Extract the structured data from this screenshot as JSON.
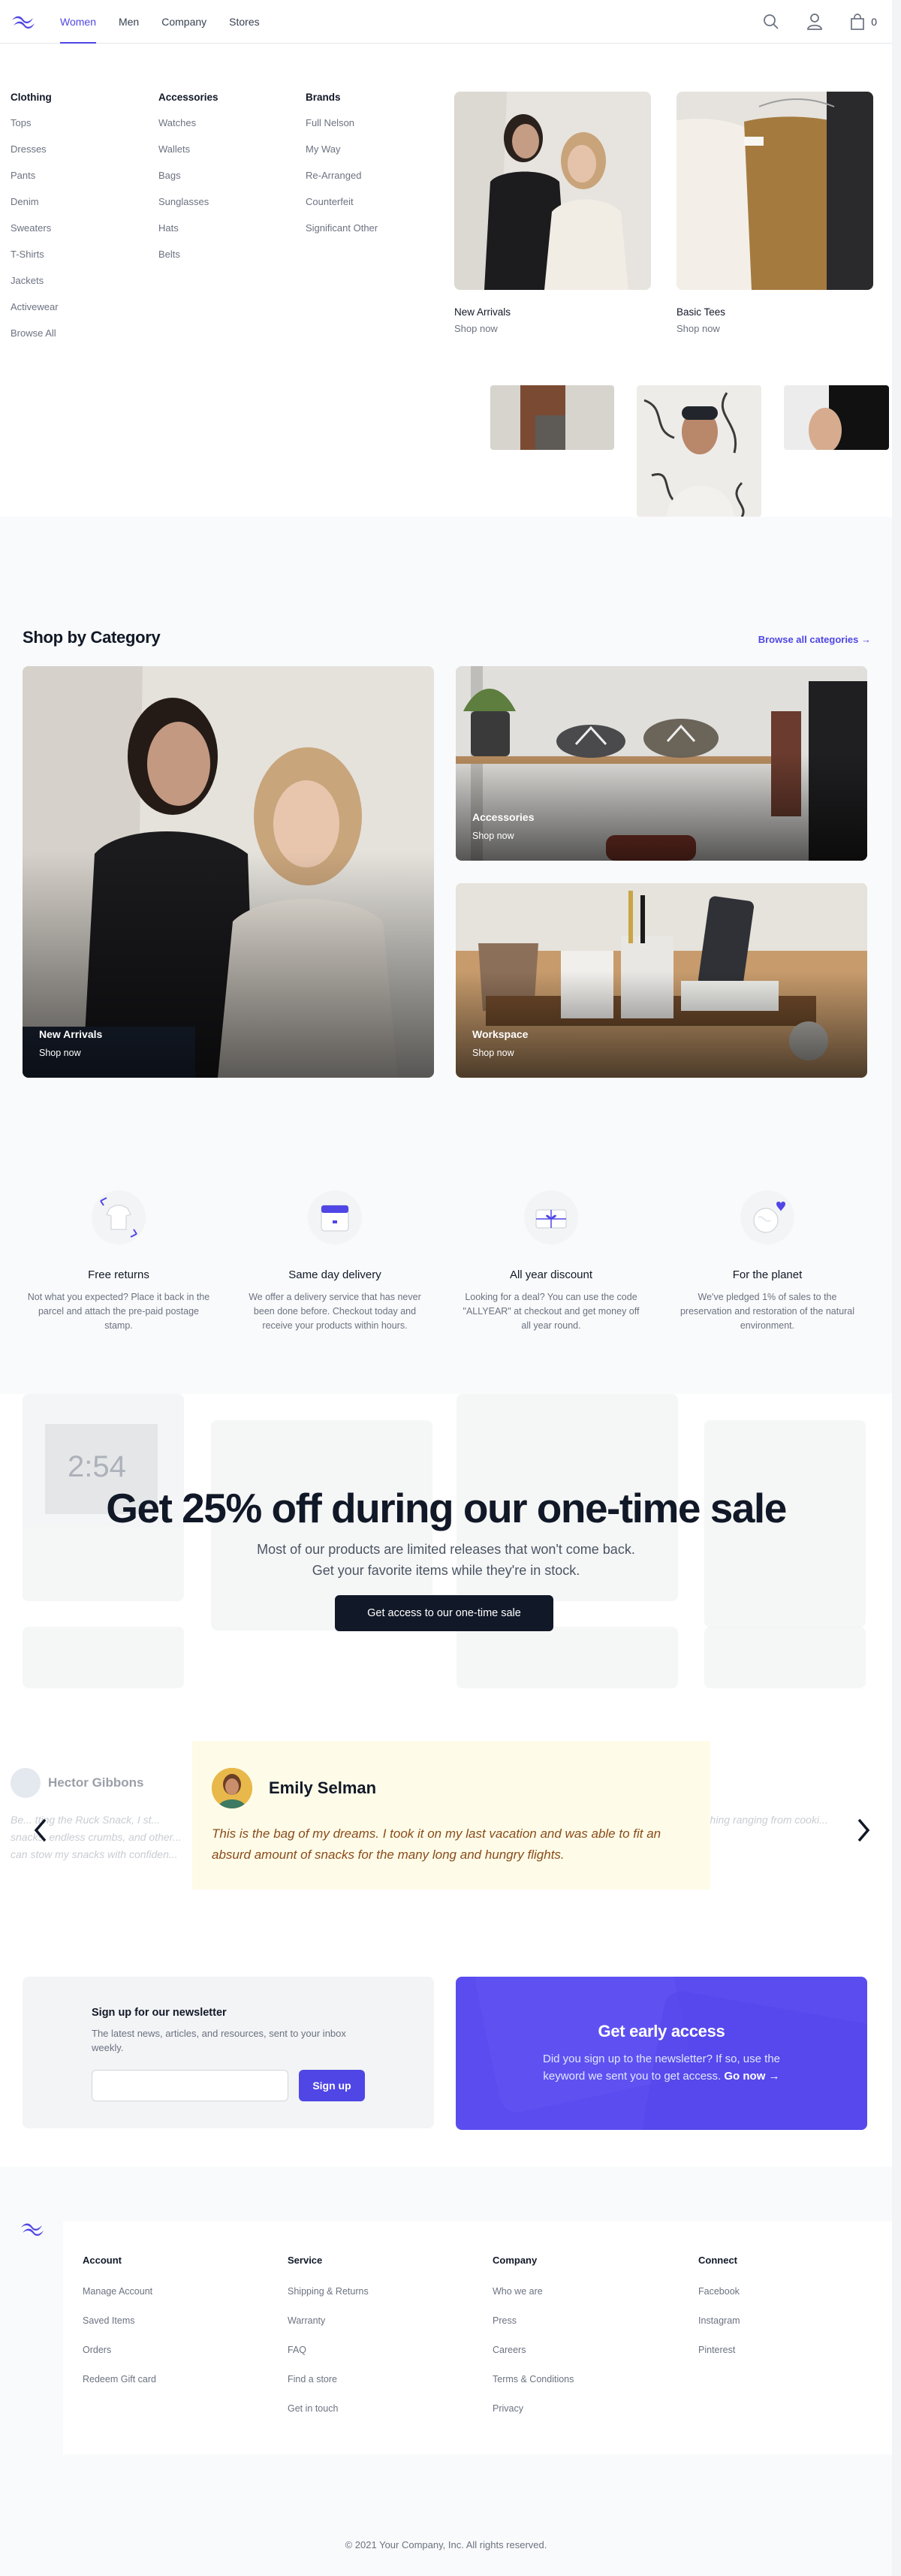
{
  "nav": {
    "links": [
      "Women",
      "Men",
      "Company",
      "Stores"
    ],
    "active": "Women",
    "cart_count": "0",
    "icons": [
      "logo-icon",
      "search-icon",
      "user-icon",
      "shopping-bag-icon"
    ]
  },
  "flyout": {
    "columns": [
      {
        "title": "Clothing",
        "items": [
          "Tops",
          "Dresses",
          "Pants",
          "Denim",
          "Sweaters",
          "T-Shirts",
          "Jackets",
          "Activewear",
          "Browse All"
        ]
      },
      {
        "title": "Accessories",
        "items": [
          "Watches",
          "Wallets",
          "Bags",
          "Sunglasses",
          "Hats",
          "Belts"
        ]
      },
      {
        "title": "Brands",
        "items": [
          "Full Nelson",
          "My Way",
          "Re-Arranged",
          "Counterfeit",
          "Significant Other"
        ]
      }
    ],
    "featured": [
      {
        "name": "New Arrivals",
        "cta": "Shop now"
      },
      {
        "name": "Basic Tees",
        "cta": "Shop now"
      }
    ]
  },
  "category": {
    "title": "Shop by Category",
    "browse_link": "Browse all categories →",
    "cards": [
      {
        "name": "New Arrivals",
        "cta": "Shop now"
      },
      {
        "name": "Accessories",
        "cta": "Shop now"
      },
      {
        "name": "Workspace",
        "cta": "Shop now"
      }
    ]
  },
  "perks": [
    {
      "title": "Free returns",
      "text": "Not what you expected? Place it back in the parcel and attach the pre-paid postage stamp."
    },
    {
      "title": "Same day delivery",
      "text": "We offer a delivery service that has never been done before. Checkout today and receive your products within hours."
    },
    {
      "title": "All year discount",
      "text": "Looking for a deal? You can use the code \"ALLYEAR\" at checkout and get money off all year round."
    },
    {
      "title": "For the planet",
      "text": "We've pledged 1% of sales to the preservation and restoration of the natural environment."
    }
  ],
  "sale": {
    "title": "Get 25% off during our one-time sale",
    "subtitle": "Most of our products are limited releases that won't come back. Get your favorite items while they're in stock.",
    "button": "Get access to our one-time sale"
  },
  "testimonials": {
    "left_name": "Hector Gibbons",
    "left_text": "Be... tting the Ruck Snack, I st... snacks, endless crumbs, and other... can stow my snacks with confiden...",
    "right_text": "...thing ranging from cooki...",
    "active": {
      "name": "Emily Selman",
      "quote": "This is the bag of my dreams. I took it on my last vacation and was able to fit an absurd amount of snacks for the many long and hungry flights."
    }
  },
  "newsletter": {
    "title": "Sign up for our newsletter",
    "text": "The latest news, articles, and resources, sent to your inbox weekly.",
    "input_value": "",
    "button": "Sign up"
  },
  "early_access": {
    "title": "Get early access",
    "text": "Did you sign up to the newsletter? If so, use the keyword we sent you to get access.",
    "link": "Go now →"
  },
  "footer": {
    "columns": [
      {
        "title": "Account",
        "items": [
          "Manage Account",
          "Saved Items",
          "Orders",
          "Redeem Gift card"
        ]
      },
      {
        "title": "Service",
        "items": [
          "Shipping & Returns",
          "Warranty",
          "FAQ",
          "Find a store",
          "Get in touch"
        ]
      },
      {
        "title": "Company",
        "items": [
          "Who we are",
          "Press",
          "Careers",
          "Terms & Conditions",
          "Privacy"
        ]
      },
      {
        "title": "Connect",
        "items": [
          "Facebook",
          "Instagram",
          "Pinterest"
        ]
      }
    ],
    "copyright": "© 2021 Your Company, Inc. All rights reserved."
  },
  "colors": {
    "accent": "#4f46e5",
    "dark": "#111827",
    "muted": "#6b7280",
    "testimonial_bg": "#fefce8",
    "early_access_bg": "#5b4cf0"
  }
}
